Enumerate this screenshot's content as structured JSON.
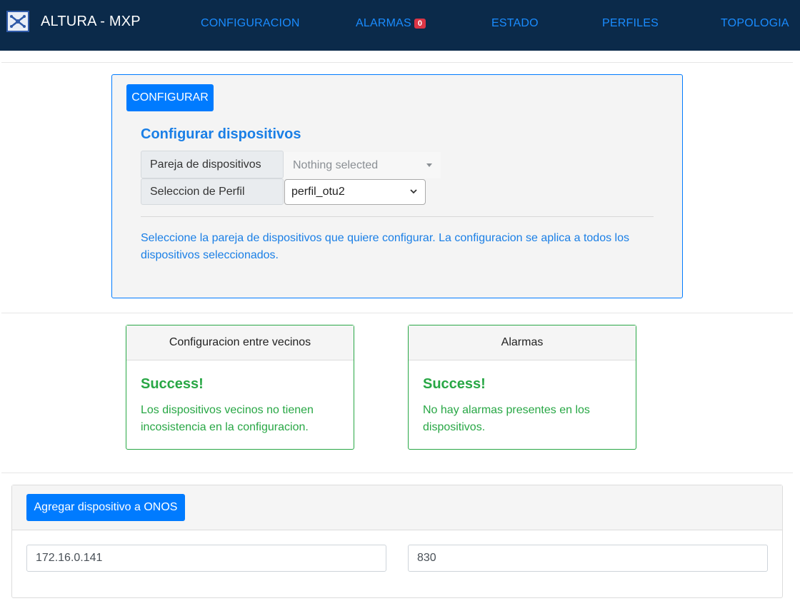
{
  "header": {
    "brand": "ALTURA - MXP",
    "nav": [
      {
        "label": "CONFIGURACION"
      },
      {
        "label": "ALARMAS",
        "badge": "0"
      },
      {
        "label": "ESTADO"
      },
      {
        "label": "PERFILES"
      },
      {
        "label": "TOPOLOGIA"
      }
    ]
  },
  "config": {
    "button": "CONFIGURAR",
    "title": "Configurar dispositivos",
    "pair_label": "Pareja de dispositivos",
    "pair_value": "Nothing selected",
    "profile_label": "Seleccion de Perfil",
    "profile_value": "perfil_otu2",
    "help": "Seleccione la pareja de dispositivos que quiere configurar. La configuracion se aplica a todos los dispositivos seleccionados."
  },
  "neighbors": {
    "header": "Configuracion entre vecinos",
    "title": "Success!",
    "text": "Los dispositivos vecinos no tienen incosistencia en la configuracion."
  },
  "alarms": {
    "header": "Alarmas",
    "title": "Success!",
    "text": "No hay alarmas presentes en los dispositivos."
  },
  "onos": {
    "button": "Agregar dispositivo a ONOS",
    "ip_value": "172.16.0.141",
    "port_value": "830"
  },
  "colors": {
    "navbar": "#0b2a4a",
    "primary": "#007bff",
    "success": "#28a745",
    "danger": "#dc3545"
  }
}
